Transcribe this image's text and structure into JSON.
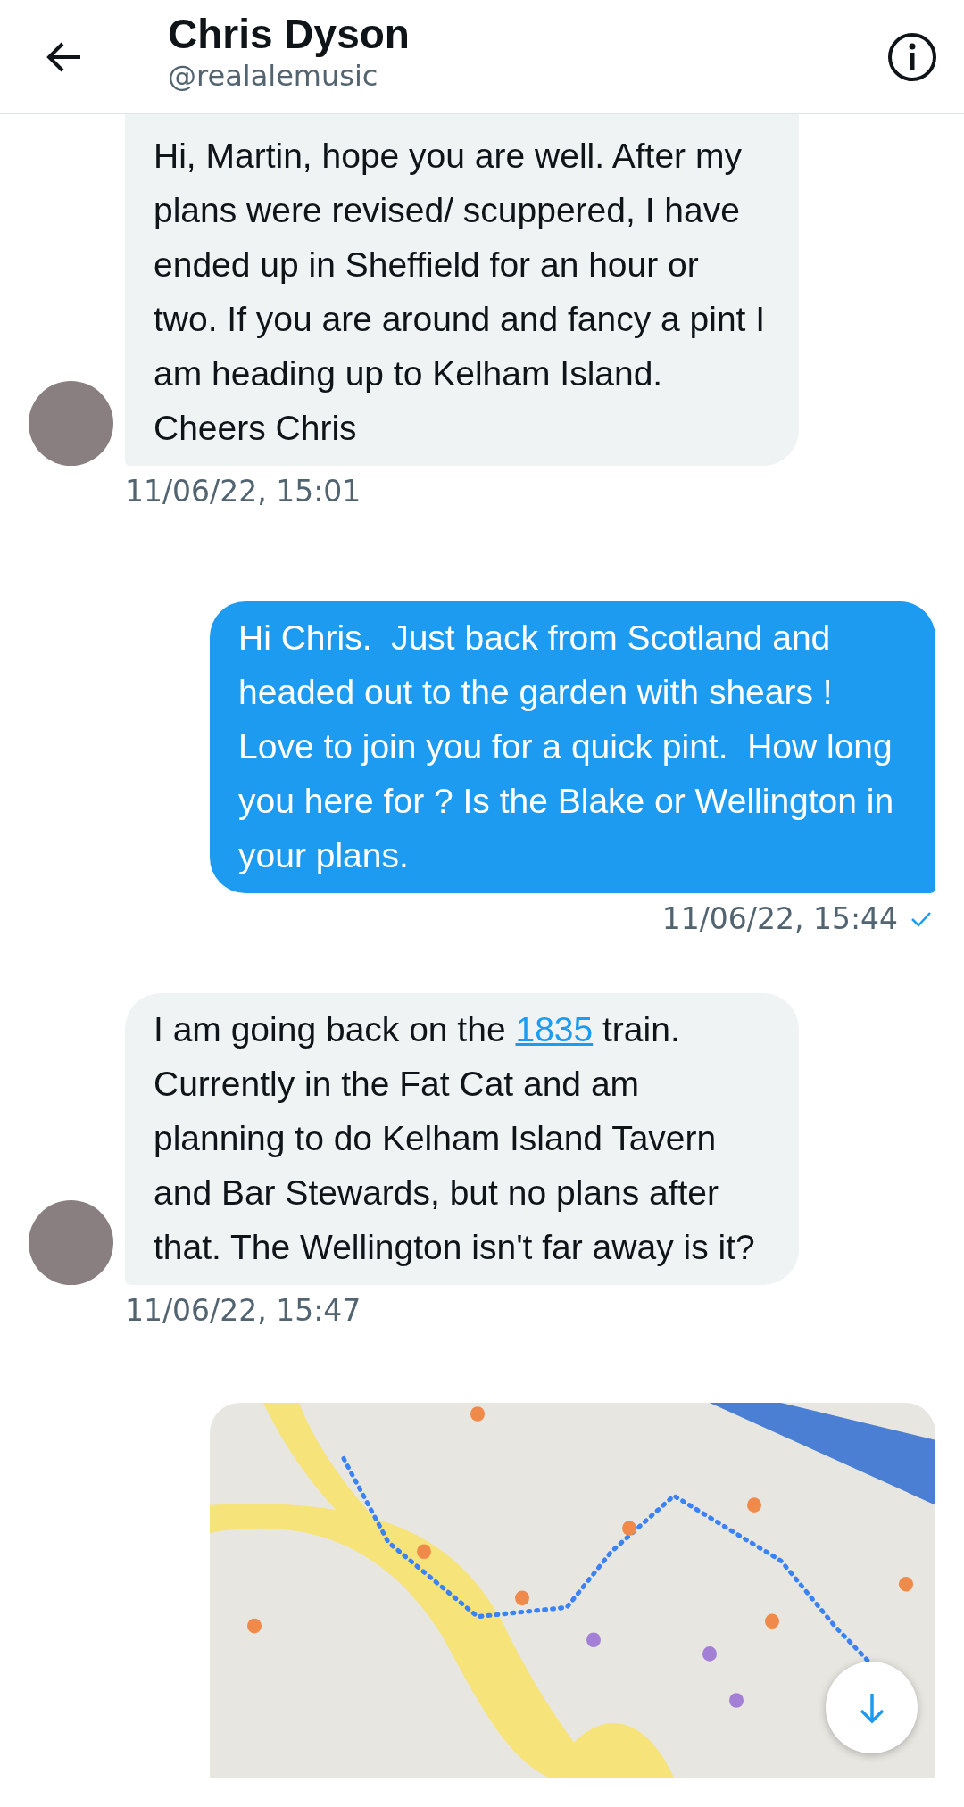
{
  "header": {
    "title": "Chris Dyson",
    "handle": "@realalemusic"
  },
  "messages": [
    {
      "kind": "received",
      "parts": [
        {
          "text": "Hi, Martin, hope you are well. After my plans were revised/ scuppered, I have ended up in Sheffield for an hour or two. If you are around and fancy a pint I am heading up to Kelham Island. Cheers Chris",
          "link": false
        }
      ],
      "time": "11/06/22, 15:01"
    },
    {
      "kind": "sent",
      "parts": [
        {
          "text": "Hi Chris.  Just back from Scotland and headed out to the garden with shears ! Love to join you for a quick pint.  How long you here for ? Is the Blake or Wellington in your plans.",
          "link": false
        }
      ],
      "time": "11/06/22, 15:44",
      "read": true
    },
    {
      "kind": "received",
      "parts": [
        {
          "text": "I am going back on the ",
          "link": false
        },
        {
          "text": "1835",
          "link": true
        },
        {
          "text": " train. Currently in the Fat Cat and am planning to do Kelham Island Tavern and Bar Stewards, but no plans after that. The Wellington isn't far away is it?",
          "link": false
        }
      ],
      "time": "11/06/22, 15:47"
    },
    {
      "kind": "image"
    }
  ]
}
